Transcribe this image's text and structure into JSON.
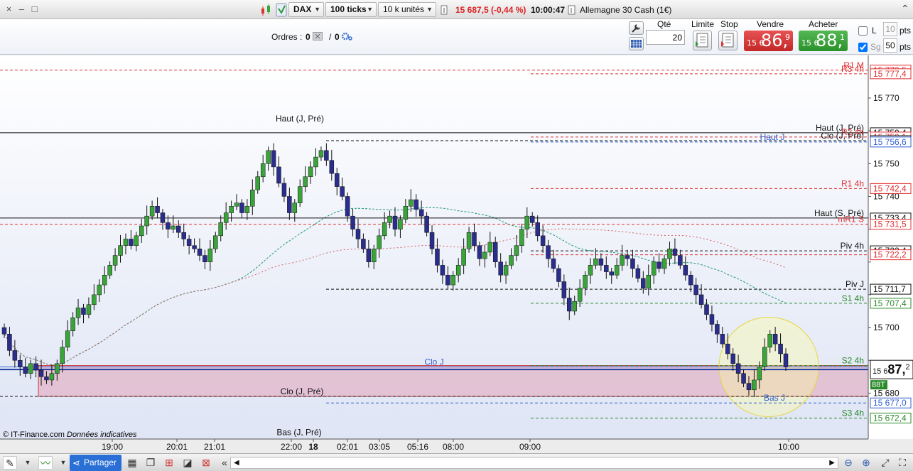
{
  "toolbar": {
    "instrument": "DAX",
    "ticks": "100 ticks",
    "units": "10 k unités",
    "price_change": "15 687,5 (-0,44 %)",
    "time": "10:00:47",
    "market": "Allemagne 30 Cash (1€)"
  },
  "orders": {
    "label": "Ordres :",
    "count1": "0",
    "sep": "/",
    "count2": "0"
  },
  "trade": {
    "qty_label": "Qté",
    "qty_value": "20",
    "limit_label": "Limite",
    "stop_label": "Stop",
    "sell_label": "Vendre",
    "sell_small": "15 6",
    "sell_big": "86,",
    "sell_tail": "9",
    "buy_label": "Acheter",
    "buy_small": "15 6",
    "buy_big": "88,",
    "buy_tail": "1",
    "l_label": "L",
    "l_value": "10",
    "l_unit": "pts",
    "sg_label": "Sg",
    "sg_value": "50",
    "sg_unit": "pts"
  },
  "colors": {
    "sell": "#d93a3a",
    "buy": "#3aa43a",
    "up_candle": "#3aa43a",
    "down_candle": "#2a2d8c",
    "resistance": "#e03030",
    "support": "#2b8a2b",
    "band": "#e2b6c8"
  },
  "footer": {
    "source": "© IT-Finance.com",
    "note": "Données indicatives",
    "share": "Partager"
  },
  "chart_data": {
    "type": "candlestick",
    "instrument": "DAX",
    "ylim": [
      15666,
      15783
    ],
    "y_ticks": [
      15680,
      15690,
      15700,
      15710,
      15720,
      15730,
      15740,
      15750,
      15760,
      15770
    ],
    "y_tick_labels": [
      "15 680",
      "",
      "15 700",
      "",
      "",
      "",
      "15 740",
      "15 750",
      "",
      "15 770"
    ],
    "x_tick_labels": [
      "19:00",
      "20:01",
      "21:01",
      "22:00",
      "18",
      "02:01",
      "03:05",
      "05:16",
      "08:00",
      "09:00",
      "10:00"
    ],
    "last_price": "15 687,2",
    "last_price_small": "15 6",
    "last_price_big": "87,",
    "last_price_tail": "2",
    "closes": [
      15698,
      15693,
      15690,
      15688,
      15686,
      15689,
      15687,
      15685,
      15684,
      15686,
      15689,
      15694,
      15699,
      15703,
      15706,
      15704,
      15707,
      15710,
      15713,
      15716,
      15719,
      15722,
      15725,
      15727,
      15725,
      15728,
      15731,
      15734,
      15737,
      15735,
      15732,
      15730,
      15731,
      15729,
      15727,
      15725,
      15724,
      15722,
      15720,
      15724,
      15728,
      15732,
      15735,
      15737,
      15738,
      15735,
      15737,
      15742,
      15746,
      15750,
      15754,
      15749,
      15744,
      15740,
      15735,
      15738,
      15743,
      15746,
      15749,
      15752,
      15754,
      15751,
      15747,
      15743,
      15740,
      15734,
      15730,
      15727,
      15724,
      15720,
      15724,
      15728,
      15732,
      15734,
      15730,
      15733,
      15737,
      15739,
      15736,
      15734,
      15729,
      15724,
      15719,
      15716,
      15713,
      15716,
      15719,
      15724,
      15729,
      15725,
      15721,
      15723,
      15726,
      15720,
      15716,
      15719,
      15722,
      15725,
      15730,
      15734,
      15732,
      15728,
      15725,
      15721,
      15718,
      15714,
      15709,
      15705,
      15708,
      15712,
      15716,
      15719,
      15721,
      15719,
      15717,
      15716,
      15719,
      15722,
      15721,
      15718,
      15715,
      15712,
      15716,
      15720,
      15718,
      15721,
      15724,
      15722,
      15719,
      15716,
      15713,
      15710,
      15707,
      15704,
      15701,
      15698,
      15695,
      15692,
      15689,
      15686,
      15683,
      15681,
      15684,
      15688,
      15694,
      15698,
      15695,
      15692,
      15688
    ],
    "levels": [
      {
        "name": "R1 M",
        "value": "15 778,5",
        "color": "#e03030"
      },
      {
        "name": "R3 4h",
        "value": "15 777,4",
        "color": "#e03030"
      },
      {
        "name": "Haut (J, Pré)",
        "value": "15 759,4",
        "color": "#111111"
      },
      {
        "name": "R2 4h",
        "value": "15 758,1",
        "color": "#e03030"
      },
      {
        "name": "Clo (J, Pré)",
        "value": "15 757,0",
        "color": "#111111"
      },
      {
        "name": "Haut J",
        "value": "15 756,6",
        "color": "#3060d0"
      },
      {
        "name": "R1 4h",
        "value": "15 742,4",
        "color": "#e03030"
      },
      {
        "name": "Haut (S, Pré)",
        "value": "15 733,4",
        "color": "#111111"
      },
      {
        "name": "mR1 S",
        "value": "15 731,5",
        "color": "#e03030"
      },
      {
        "name": "Piv 4h",
        "value": "15 723,4",
        "color": "#111111"
      },
      {
        "name": "",
        "value": "15 722,2",
        "color": "#e03030"
      },
      {
        "name": "Piv J",
        "value": "15 711,7",
        "color": "#111111"
      },
      {
        "name": "S1 4h",
        "value": "15 707,4",
        "color": "#2b8a2b"
      },
      {
        "name": "S2 4h",
        "value": "15 688,4",
        "color": "#2b8a2b"
      },
      {
        "name": "Clo J",
        "value": "",
        "color": "#3060d0"
      },
      {
        "name": "Clo (J, Pré)",
        "value": "",
        "color": "#111111"
      },
      {
        "name": "Bas J",
        "value": "15 677,0",
        "color": "#3060d0"
      },
      {
        "name": "S3 4h",
        "value": "15 672,4",
        "color": "#2b8a2b"
      },
      {
        "name": "Bas (J, Pré)",
        "value": "",
        "color": "#111111"
      }
    ],
    "annotations": [
      "88T"
    ]
  }
}
